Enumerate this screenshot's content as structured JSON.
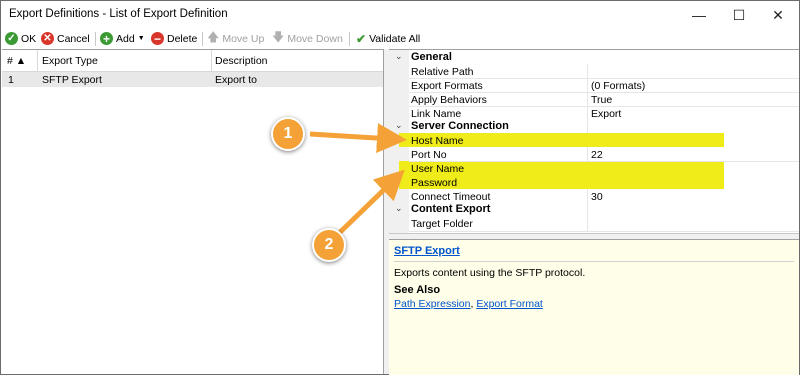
{
  "window": {
    "title": "Export Definitions - List of Export Definition",
    "minimize": "—",
    "maximize": "☐",
    "close": "✕"
  },
  "toolbar": {
    "ok": "OK",
    "cancel": "Cancel",
    "add": "Add",
    "delete": "Delete",
    "move_up": "Move Up",
    "move_down": "Move Down",
    "validate_all": "Validate All"
  },
  "list": {
    "headers": {
      "num": "# ▲",
      "type": "Export Type",
      "description": "Description"
    },
    "rows": [
      {
        "num": "1",
        "type": "SFTP Export",
        "description": "Export to"
      }
    ]
  },
  "properties": {
    "general": {
      "label": "General",
      "items": [
        {
          "name": "Relative Path",
          "value": ""
        },
        {
          "name": "Export Formats",
          "value": "(0 Formats)"
        },
        {
          "name": "Apply Behaviors",
          "value": "True"
        },
        {
          "name": "Link Name",
          "value": "Export"
        }
      ]
    },
    "server": {
      "label": "Server Connection",
      "items": [
        {
          "name": "Host Name",
          "value": ""
        },
        {
          "name": "Port No",
          "value": "22"
        },
        {
          "name": "User Name",
          "value": ""
        },
        {
          "name": "Password",
          "value": ""
        },
        {
          "name": "Connect Timeout",
          "value": "30"
        }
      ]
    },
    "content": {
      "label": "Content Export",
      "items": [
        {
          "name": "Target Folder",
          "value": ""
        }
      ]
    }
  },
  "help": {
    "title": "SFTP Export",
    "description": "Exports content using the SFTP protocol.",
    "see_also": "See Also",
    "links": [
      "Path Expression",
      "Export Format"
    ],
    "separator": ", "
  },
  "callouts": {
    "one": "1",
    "two": "2"
  },
  "colors": {
    "highlight": "#f0ec19",
    "callout": "#f4a237",
    "link": "#0055cc"
  }
}
